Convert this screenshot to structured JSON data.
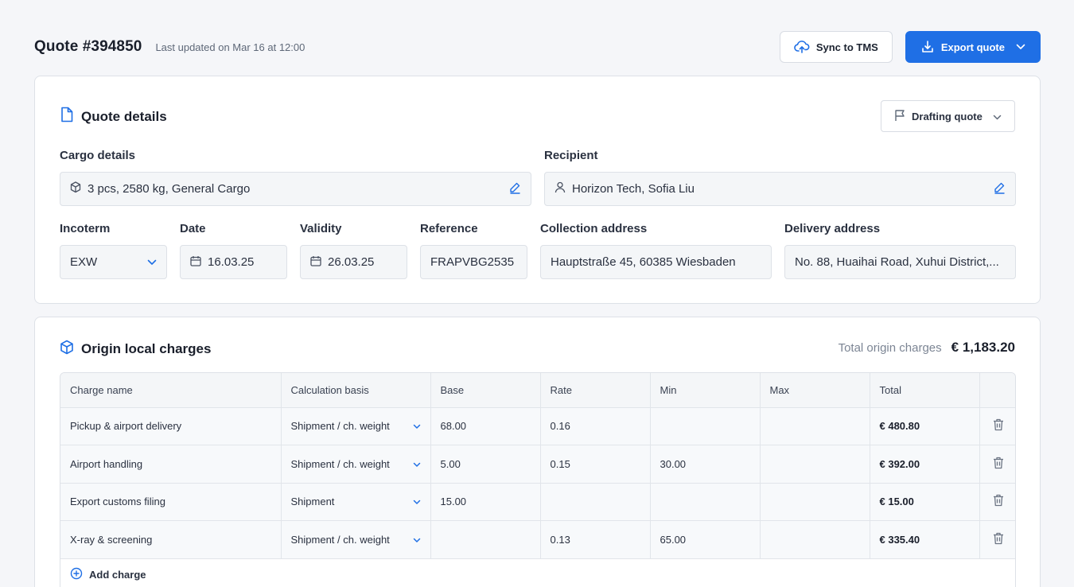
{
  "header": {
    "title": "Quote #394850",
    "updated": "Last updated on Mar 16 at 12:00",
    "sync_label": "Sync to TMS",
    "export_label": "Export quote"
  },
  "quote_details": {
    "title": "Quote details",
    "status": "Drafting quote",
    "cargo_label": "Cargo details",
    "cargo_value": "3 pcs, 2580 kg, General Cargo",
    "recipient_label": "Recipient",
    "recipient_value": "Horizon Tech, Sofia Liu",
    "incoterm_label": "Incoterm",
    "incoterm_value": "EXW",
    "date_label": "Date",
    "date_value": "16.03.25",
    "validity_label": "Validity",
    "validity_value": "26.03.25",
    "reference_label": "Reference",
    "reference_value": "FRAPVBG2535",
    "collection_label": "Collection address",
    "collection_value": "Hauptstraße 45, 60385 Wiesbaden",
    "delivery_label": "Delivery address",
    "delivery_value": "No. 88, Huaihai Road, Xuhui District,..."
  },
  "origin_charges": {
    "title": "Origin local charges",
    "total_label": "Total origin charges",
    "total_value": "€ 1,183.20",
    "columns": [
      "Charge name",
      "Calculation basis",
      "Base",
      "Rate",
      "Min",
      "Max",
      "Total"
    ],
    "rows": [
      {
        "name": "Pickup & airport delivery",
        "basis": "Shipment / ch. weight",
        "base": "68.00",
        "rate": "0.16",
        "min": "",
        "max": "",
        "total": "€ 480.80"
      },
      {
        "name": "Airport handling",
        "basis": "Shipment / ch. weight",
        "base": "5.00",
        "rate": "0.15",
        "min": "30.00",
        "max": "",
        "total": "€ 392.00"
      },
      {
        "name": "Export customs filing",
        "basis": "Shipment",
        "base": "15.00",
        "rate": "",
        "min": "",
        "max": "",
        "total": "€ 15.00"
      },
      {
        "name": "X-ray & screening",
        "basis": "Shipment / ch. weight",
        "base": "",
        "rate": "0.13",
        "min": "65.00",
        "max": "",
        "total": "€ 335.40"
      }
    ],
    "add_label": "Add charge"
  },
  "colors": {
    "accent": "#1f6fe5",
    "background": "#f5f6f9",
    "field_bg": "#f4f6f8"
  }
}
